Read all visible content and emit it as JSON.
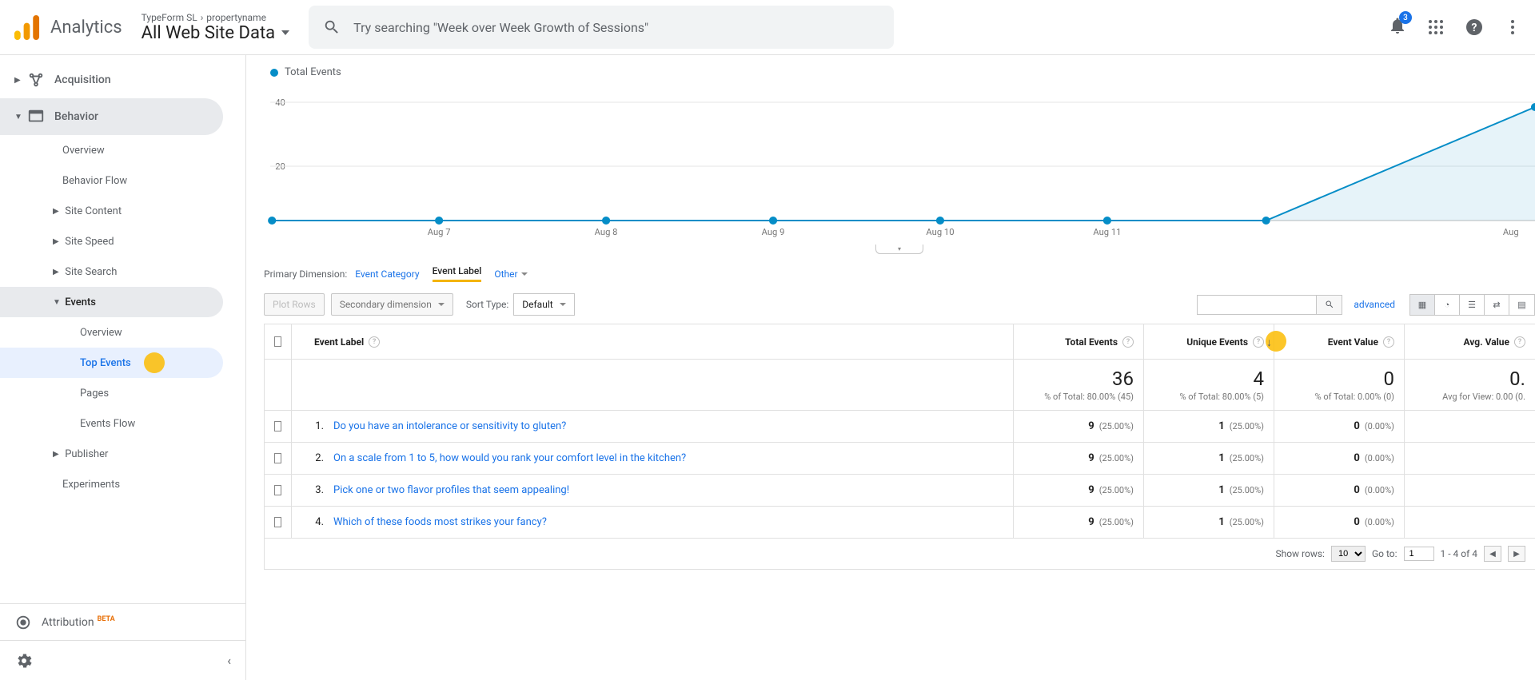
{
  "header": {
    "app_name": "Analytics",
    "breadcrumb_account": "TypeForm SL",
    "breadcrumb_property": "propertyname",
    "view_name": "All Web Site Data",
    "search_placeholder": "Try searching \"Week over Week Growth of Sessions\"",
    "notification_count": "3"
  },
  "sidebar": {
    "acquisition": "Acquisition",
    "behavior": "Behavior",
    "overview": "Overview",
    "behavior_flow": "Behavior Flow",
    "site_content": "Site Content",
    "site_speed": "Site Speed",
    "site_search": "Site Search",
    "events": "Events",
    "events_overview": "Overview",
    "top_events": "Top Events",
    "pages": "Pages",
    "events_flow": "Events Flow",
    "publisher": "Publisher",
    "experiments": "Experiments",
    "attribution": "Attribution",
    "beta": "BETA"
  },
  "chart_data": {
    "type": "line",
    "legend": "Total Events",
    "ylabel": "",
    "ylim": [
      0,
      40
    ],
    "yticks": [
      20,
      40
    ],
    "categories": [
      "Aug 7",
      "Aug 8",
      "Aug 9",
      "Aug 10",
      "Aug 11",
      "Aug"
    ],
    "values": [
      0,
      0,
      0,
      0,
      0,
      36
    ]
  },
  "dimensions": {
    "label": "Primary Dimension:",
    "event_category": "Event Category",
    "event_label": "Event Label",
    "other": "Other"
  },
  "toolbar": {
    "plot_rows": "Plot Rows",
    "secondary_dimension": "Secondary dimension",
    "sort_type_label": "Sort Type:",
    "sort_type_value": "Default",
    "advanced": "advanced"
  },
  "table": {
    "cols": {
      "event_label": "Event Label",
      "total_events": "Total Events",
      "unique_events": "Unique Events",
      "event_value": "Event Value",
      "avg_value": "Avg. Value"
    },
    "summary": {
      "total_events": "36",
      "total_events_pct": "% of Total: 80.00% (45)",
      "unique_events": "4",
      "unique_events_pct": "% of Total: 80.00% (5)",
      "event_value": "0",
      "event_value_pct": "% of Total: 0.00% (0)",
      "avg_value": "0.",
      "avg_value_pct": "Avg for View: 0.00 (0."
    },
    "rows": [
      {
        "idx": "1.",
        "label": "Do you have an intolerance or sensitivity to gluten?",
        "te_v": "9",
        "te_p": "(25.00%)",
        "ue_v": "1",
        "ue_p": "(25.00%)",
        "ev_v": "0",
        "ev_p": "(0.00%)"
      },
      {
        "idx": "2.",
        "label": "On a scale from 1 to 5, how would you rank your comfort level in the kitchen?",
        "te_v": "9",
        "te_p": "(25.00%)",
        "ue_v": "1",
        "ue_p": "(25.00%)",
        "ev_v": "0",
        "ev_p": "(0.00%)"
      },
      {
        "idx": "3.",
        "label": "Pick one or two flavor profiles that seem appealing!",
        "te_v": "9",
        "te_p": "(25.00%)",
        "ue_v": "1",
        "ue_p": "(25.00%)",
        "ev_v": "0",
        "ev_p": "(0.00%)"
      },
      {
        "idx": "4.",
        "label": "Which of these foods most strikes your fancy?",
        "te_v": "9",
        "te_p": "(25.00%)",
        "ue_v": "1",
        "ue_p": "(25.00%)",
        "ev_v": "0",
        "ev_p": "(0.00%)"
      }
    ],
    "footer": {
      "show_rows": "Show rows:",
      "rows_value": "10",
      "go_to": "Go to:",
      "go_to_value": "1",
      "range": "1 - 4 of 4"
    }
  }
}
